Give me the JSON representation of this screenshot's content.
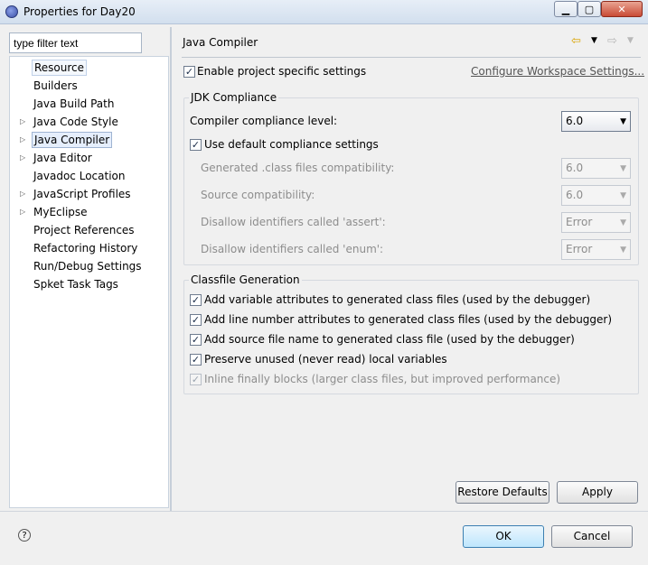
{
  "window": {
    "title": "Properties for Day20"
  },
  "filter": {
    "placeholder": "type filter text"
  },
  "tree": {
    "items": [
      {
        "label": "Resource",
        "expandable": false
      },
      {
        "label": "Builders",
        "expandable": false
      },
      {
        "label": "Java Build Path",
        "expandable": false
      },
      {
        "label": "Java Code Style",
        "expandable": true
      },
      {
        "label": "Java Compiler",
        "expandable": true,
        "selected": true
      },
      {
        "label": "Java Editor",
        "expandable": true
      },
      {
        "label": "Javadoc Location",
        "expandable": false
      },
      {
        "label": "JavaScript Profiles",
        "expandable": true
      },
      {
        "label": "MyEclipse",
        "expandable": true
      },
      {
        "label": "Project References",
        "expandable": false
      },
      {
        "label": "Refactoring History",
        "expandable": false
      },
      {
        "label": "Run/Debug Settings",
        "expandable": false
      },
      {
        "label": "Spket Task Tags",
        "expandable": false
      }
    ]
  },
  "page": {
    "title": "Java Compiler",
    "enable_project": {
      "label": "Enable project specific settings",
      "checked": true
    },
    "configure_link": "Configure Workspace Settings...",
    "jdk": {
      "title": "JDK Compliance",
      "level_label": "Compiler compliance level:",
      "level_value": "6.0",
      "use_default": {
        "label": "Use default compliance settings",
        "checked": true
      },
      "generated": {
        "label": "Generated .class files compatibility:",
        "value": "6.0"
      },
      "source": {
        "label": "Source compatibility:",
        "value": "6.0"
      },
      "assert": {
        "label": "Disallow identifiers called 'assert':",
        "value": "Error"
      },
      "enum": {
        "label": "Disallow identifiers called 'enum':",
        "value": "Error"
      }
    },
    "classfile": {
      "title": "Classfile Generation",
      "options": [
        {
          "label": "Add variable attributes to generated class files (used by the debugger)",
          "checked": true,
          "enabled": true
        },
        {
          "label": "Add line number attributes to generated class files (used by the debugger)",
          "checked": true,
          "enabled": true
        },
        {
          "label": "Add source file name to generated class file (used by the debugger)",
          "checked": true,
          "enabled": true
        },
        {
          "label": "Preserve unused (never read) local variables",
          "checked": true,
          "enabled": true
        },
        {
          "label": "Inline finally blocks (larger class files, but improved performance)",
          "checked": true,
          "enabled": false
        }
      ]
    },
    "restore_defaults": "Restore Defaults",
    "apply": "Apply"
  },
  "footer": {
    "ok": "OK",
    "cancel": "Cancel"
  }
}
